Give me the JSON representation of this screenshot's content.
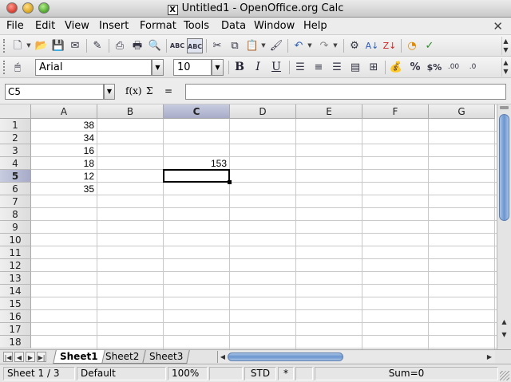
{
  "window": {
    "title": "Untitled1 - OpenOffice.org Calc"
  },
  "menu": [
    "File",
    "Edit",
    "View",
    "Insert",
    "Format",
    "Tools",
    "Data",
    "Window",
    "Help"
  ],
  "toolbar": {
    "font_name": "Arial",
    "font_size": "10",
    "bold": "B",
    "italic": "I",
    "underline": "U"
  },
  "formula": {
    "cell_ref": "C5",
    "fx": "f(x)",
    "sum": "Σ",
    "equals": "=",
    "content": ""
  },
  "columns": [
    "A",
    "B",
    "C",
    "D",
    "E",
    "F",
    "G"
  ],
  "selected_column": "C",
  "rows": [
    "1",
    "2",
    "3",
    "4",
    "5",
    "6",
    "7",
    "8",
    "9",
    "10",
    "11",
    "12",
    "13",
    "14",
    "15",
    "16",
    "17",
    "18"
  ],
  "selected_row": "5",
  "cells": {
    "A1": "38",
    "A2": "34",
    "A3": "16",
    "A4": "18",
    "A5": "12",
    "A6": "35",
    "C4": "153"
  },
  "sheets": [
    "Sheet1",
    "Sheet2",
    "Sheet3"
  ],
  "active_sheet": "Sheet1",
  "status": {
    "sheet": "Sheet 1 / 3",
    "style": "Default",
    "zoom": "100%",
    "mode": "STD",
    "modified": "*",
    "sum": "Sum=0"
  }
}
